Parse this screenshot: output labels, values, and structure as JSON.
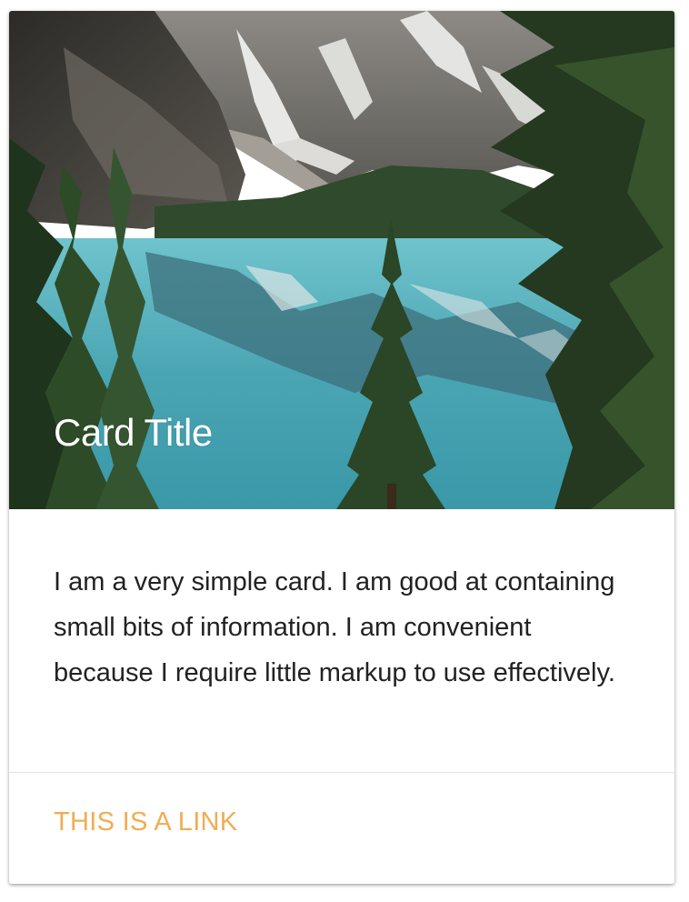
{
  "card": {
    "title": "Card Title",
    "image_alt": "mountain-lake-landscape",
    "content": "I am a very simple card. I am good at containing small bits of information. I am convenient because I require little markup to use effectively.",
    "link_label": "THIS IS A LINK"
  },
  "colors": {
    "link": "#f0ad52",
    "text": "#222222",
    "title": "#ffffff",
    "lake": "#4fa9b8",
    "sky": "#a9c8e6"
  }
}
